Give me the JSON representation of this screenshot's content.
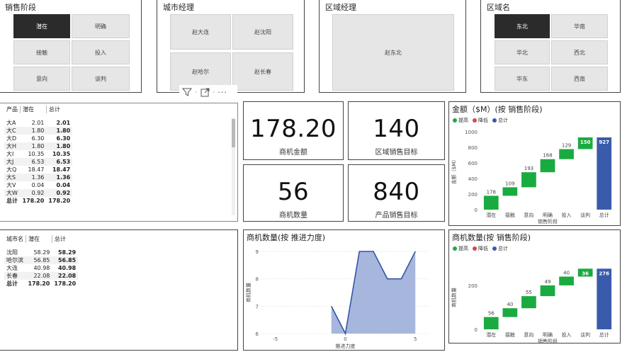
{
  "slicers": {
    "stage": {
      "title": "销售阶段",
      "items": [
        "潜在",
        "明确",
        "接触",
        "投入",
        "意向",
        "谈判"
      ],
      "selected": "潜在"
    },
    "city_manager": {
      "title": "城市经理",
      "items": [
        "赵大连",
        "赵沈阳",
        "赵哈尔",
        "赵长春"
      ]
    },
    "region_manager": {
      "title": "区域经理",
      "items": [
        "赵东北"
      ]
    },
    "region": {
      "title": "区域名",
      "items": [
        "东北",
        "华南",
        "华北",
        "西北",
        "华东",
        "西南"
      ],
      "selected": "东北"
    }
  },
  "kpis": [
    {
      "value": "178.20",
      "label": "商机金额"
    },
    {
      "value": "140",
      "label": "区域销售目标"
    },
    {
      "value": "56",
      "label": "商机数量"
    },
    {
      "value": "840",
      "label": "产品销售目标"
    }
  ],
  "product_table": {
    "headers": [
      "产品",
      "潜在",
      "总计"
    ],
    "rows": [
      [
        "大A",
        "2.01",
        "2.01"
      ],
      [
        "大C",
        "1.80",
        "1.80"
      ],
      [
        "大D",
        "6.30",
        "6.30"
      ],
      [
        "大H",
        "1.80",
        "1.80"
      ],
      [
        "大I",
        "10.35",
        "10.35"
      ],
      [
        "大J",
        "6.53",
        "6.53"
      ],
      [
        "大Q",
        "18.47",
        "18.47"
      ],
      [
        "大S",
        "1.36",
        "1.36"
      ],
      [
        "大V",
        "0.04",
        "0.04"
      ],
      [
        "大W",
        "0.92",
        "0.92"
      ]
    ],
    "total": [
      "总计",
      "178.20",
      "178.20"
    ]
  },
  "city_table": {
    "headers": [
      "城市名",
      "潜在",
      "总计"
    ],
    "rows": [
      [
        "沈阳",
        "58.29",
        "58.29"
      ],
      [
        "哈尔滨",
        "56.85",
        "56.85"
      ],
      [
        "大连",
        "40.98",
        "40.98"
      ],
      [
        "长春",
        "22.08",
        "22.08"
      ]
    ],
    "total": [
      "总计",
      "178.20",
      "178.20"
    ]
  },
  "toolbar": {
    "filter": "filter-icon",
    "focus": "focus-mode-icon",
    "more": "more-options-icon"
  },
  "chart_data": [
    {
      "type": "waterfall",
      "title": "金额（$M）(按 销售阶段)",
      "legend": [
        "提高",
        "降低",
        "总计"
      ],
      "legend_colors": [
        "#1aab40",
        "#d64550",
        "#3a5bab"
      ],
      "categories": [
        "潜在",
        "接触",
        "意向",
        "明确",
        "投入",
        "谈判",
        "总计"
      ],
      "values": [
        178,
        109,
        193,
        168,
        129,
        150,
        927
      ],
      "xlabel": "销售阶段",
      "ylabel": "金额（$M）",
      "yticks": [
        0,
        200,
        400,
        600,
        800,
        1000
      ],
      "ylim": [
        0,
        1000
      ]
    },
    {
      "type": "area",
      "title": "商机数量(按 推进力度)",
      "x": [
        0,
        1,
        2,
        3,
        4,
        5
      ],
      "y": [
        7,
        6,
        9,
        9,
        8,
        8,
        9
      ],
      "points": [
        [
          -1,
          7
        ],
        [
          0,
          6
        ],
        [
          1,
          9
        ],
        [
          2,
          9
        ],
        [
          3,
          8
        ],
        [
          4,
          8
        ],
        [
          5,
          9
        ]
      ],
      "xticks": [
        -5,
        0,
        5
      ],
      "yticks": [
        6,
        7,
        8,
        9
      ],
      "xlabel": "推进力度",
      "ylabel": "商机数量",
      "ylim": [
        6,
        9
      ]
    },
    {
      "type": "waterfall",
      "title": "商机数量(按 销售阶段)",
      "legend": [
        "提高",
        "降低",
        "总计"
      ],
      "legend_colors": [
        "#1aab40",
        "#d64550",
        "#3a5bab"
      ],
      "categories": [
        "潜在",
        "接触",
        "意向",
        "明确",
        "投入",
        "谈判",
        "总计"
      ],
      "values": [
        56,
        40,
        55,
        49,
        40,
        36,
        276
      ],
      "xlabel": "销售阶段",
      "ylabel": "商机数量",
      "yticks": [
        0,
        200
      ],
      "ylim": [
        0,
        290
      ]
    }
  ]
}
